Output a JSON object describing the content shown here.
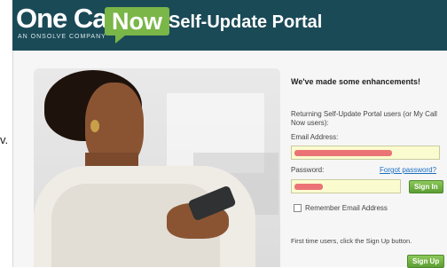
{
  "edge": {
    "text": "v."
  },
  "brand": {
    "logo_one_call": "One Call",
    "logo_now": "Now",
    "tagline": "AN ONSOLVE COMPANY",
    "portal_title": "Self-Update Portal"
  },
  "panel": {
    "enhancements": "We've made some enhancements!",
    "returning_users": "Returning Self-Update Portal users (or My Call Now users):",
    "email_label": "Email Address:",
    "password_label": "Password:",
    "forgot_password": "Forgot password?",
    "sign_in": "Sign In",
    "remember_email": "Remember Email Address",
    "first_time": "First time users, click the Sign Up button.",
    "sign_up": "Sign Up"
  },
  "colors": {
    "header_bg": "#1b4a57",
    "brand_green": "#7ab648",
    "input_bg": "#fafbcf",
    "link": "#1a6ec1"
  }
}
